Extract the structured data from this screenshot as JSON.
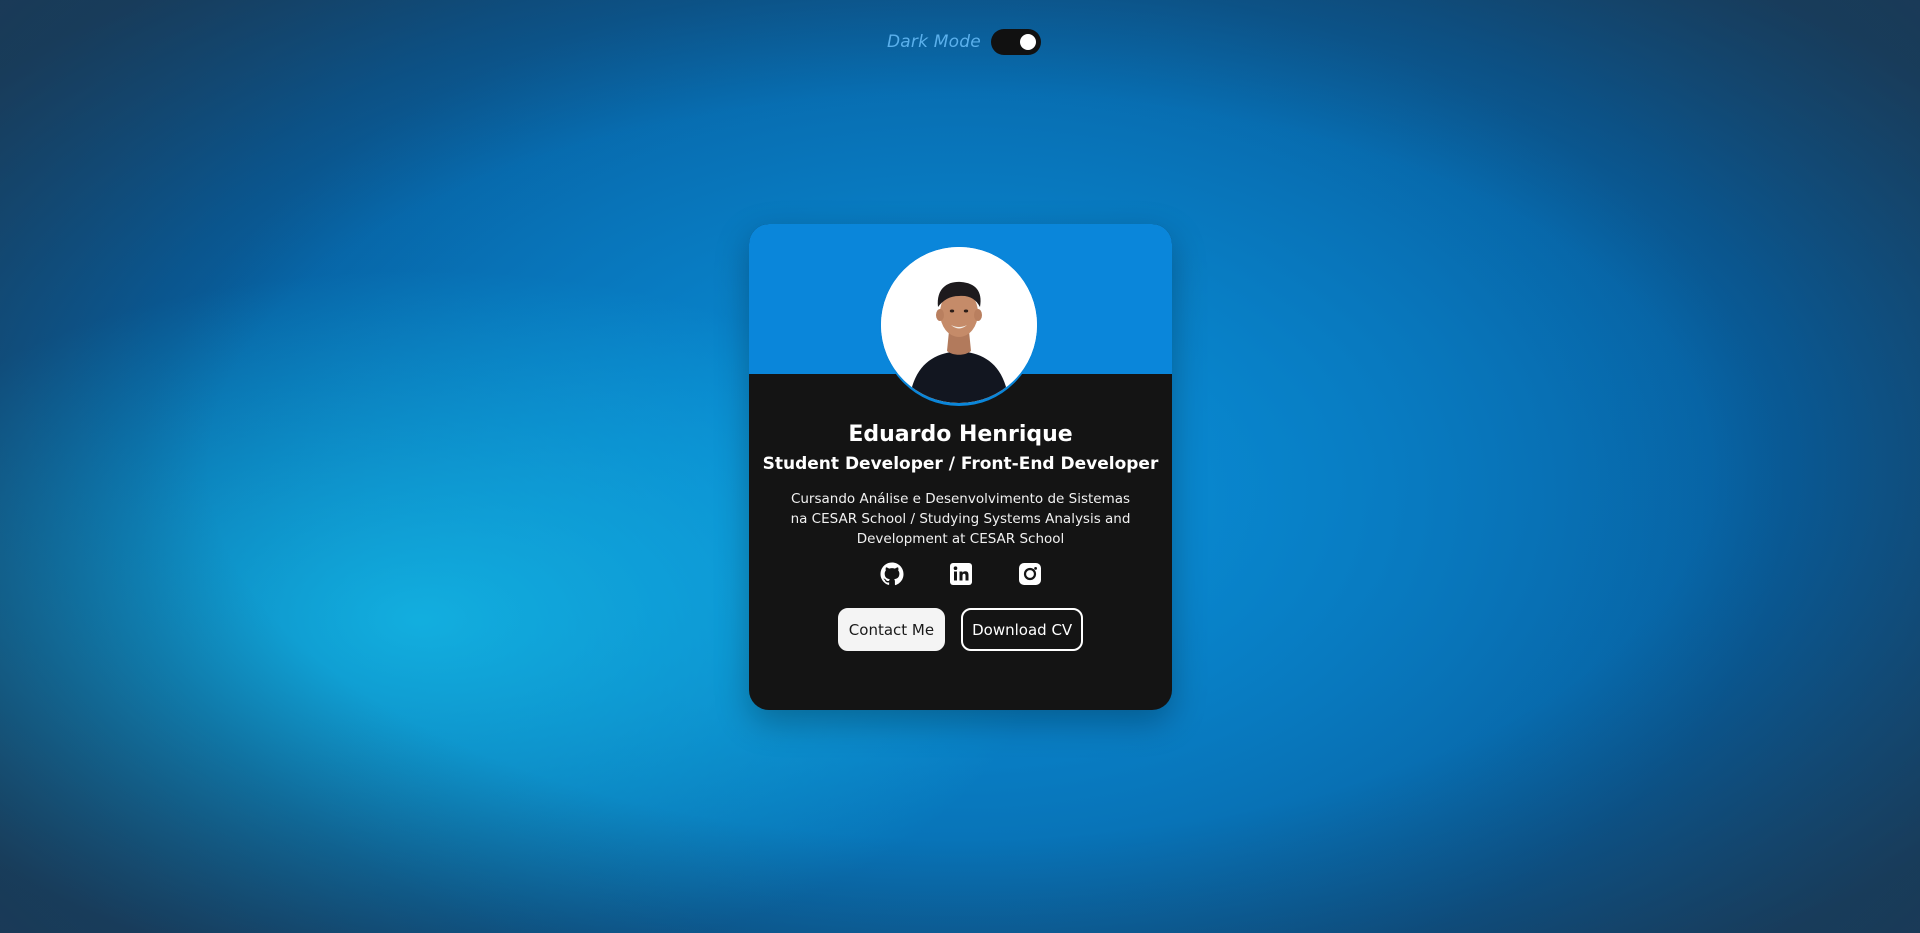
{
  "header": {
    "dark_mode_label": "Dark Mode",
    "dark_mode_on": true
  },
  "profile": {
    "name": "Eduardo Henrique",
    "role": "Student Developer / Front-End Developer",
    "bio": "Cursando Análise e Desenvolvimento de Sistemas na CESAR School / Studying Systems Analysis and Development at CESAR School",
    "socials": [
      {
        "icon": "github-icon"
      },
      {
        "icon": "linkedin-icon"
      },
      {
        "icon": "instagram-icon"
      }
    ],
    "buttons": {
      "contact_label": "Contact Me",
      "download_label": "Download CV"
    }
  },
  "colors": {
    "card_header": "#0a86da",
    "card_body": "#141414",
    "toggle_label": "#5bb0ec"
  }
}
